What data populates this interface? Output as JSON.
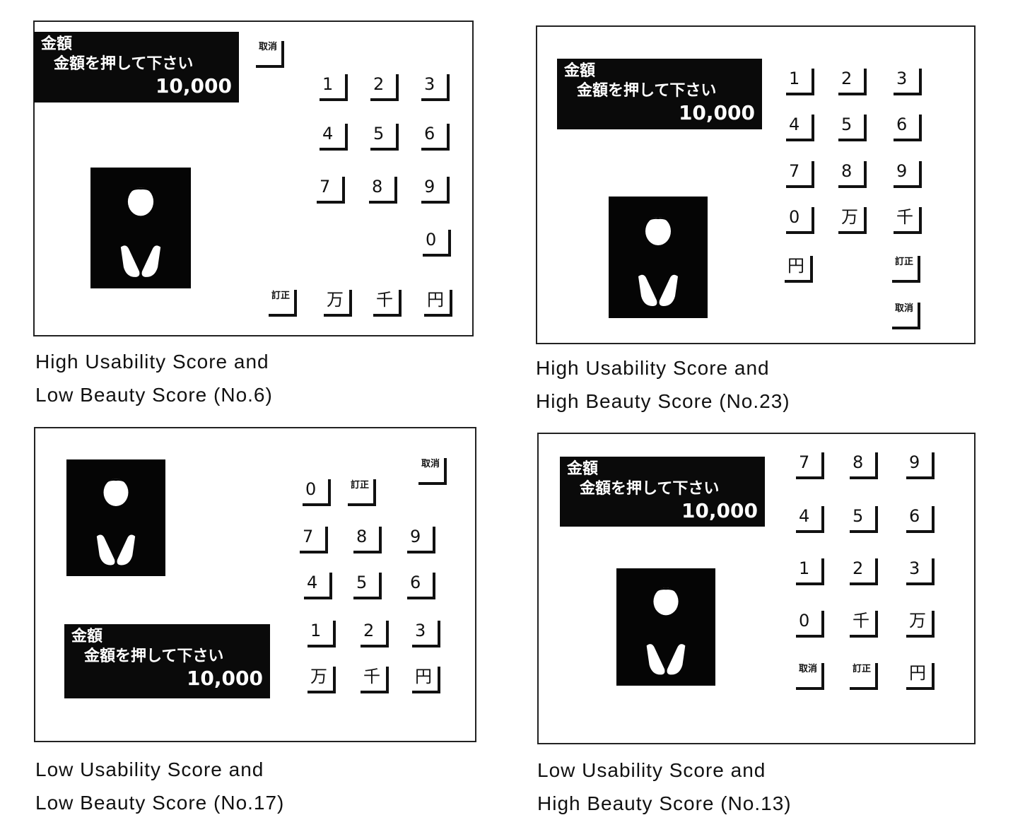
{
  "panels": [
    {
      "display": {
        "title": "金額",
        "prompt": "金額を押して下さい",
        "amount": "10,000"
      },
      "keys": [
        "取消",
        "1",
        "2",
        "3",
        "4",
        "5",
        "6",
        "7",
        "8",
        "9",
        "0",
        "訂正",
        "万",
        "千",
        "円"
      ],
      "caption": [
        "High Usability Score and",
        "Low Beauty Score (No.6)"
      ]
    },
    {
      "display": {
        "title": "金額",
        "prompt": "金額を押して下さい",
        "amount": "10,000"
      },
      "keys": [
        "1",
        "2",
        "3",
        "4",
        "5",
        "6",
        "7",
        "8",
        "9",
        "0",
        "万",
        "千",
        "円",
        "訂正",
        "取消"
      ],
      "caption": [
        "High Usability Score and",
        "High Beauty Score (No.23)"
      ]
    },
    {
      "display": {
        "title": "金額",
        "prompt": "金額を押して下さい",
        "amount": "10,000"
      },
      "keys": [
        "取消",
        "0",
        "訂正",
        "7",
        "8",
        "9",
        "4",
        "5",
        "6",
        "1",
        "2",
        "3",
        "万",
        "千",
        "円"
      ],
      "caption": [
        "Low Usability Score and",
        "Low Beauty Score (No.17)"
      ]
    },
    {
      "display": {
        "title": "金額",
        "prompt": "金額を押して下さい",
        "amount": "10,000"
      },
      "keys": [
        "7",
        "8",
        "9",
        "4",
        "5",
        "6",
        "1",
        "2",
        "3",
        "0",
        "千",
        "万",
        "取消",
        "訂正",
        "円"
      ],
      "caption": [
        "Low Usability Score and",
        "High Beauty Score (No.13)"
      ]
    }
  ]
}
